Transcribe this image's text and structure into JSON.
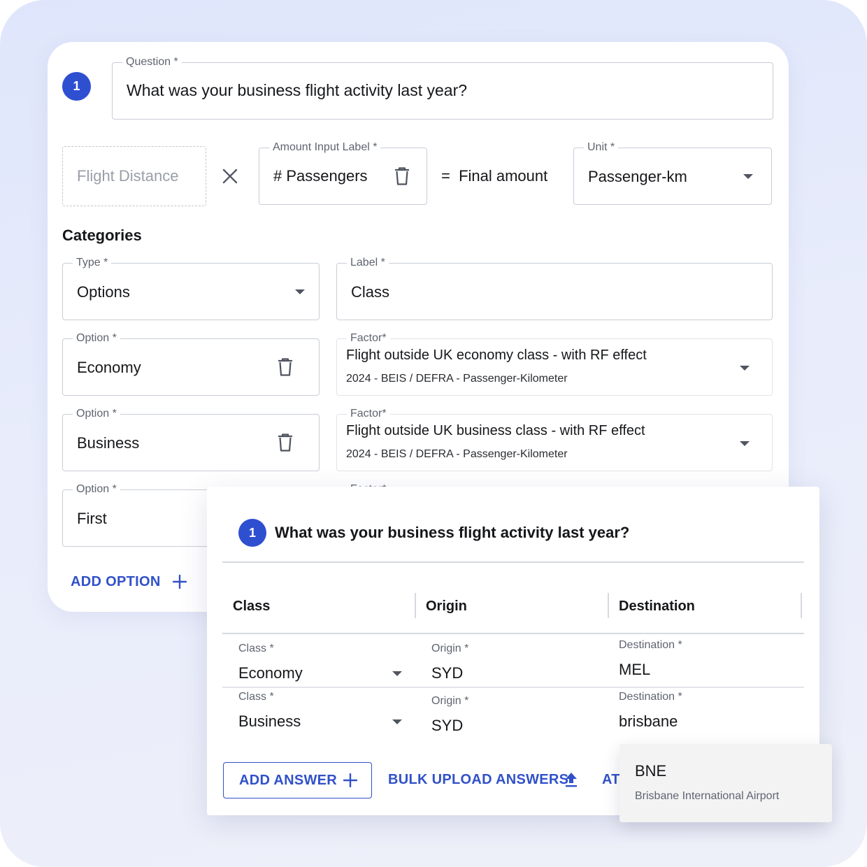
{
  "builder": {
    "step_number": "1",
    "question": {
      "label": "Question *",
      "value": "What was your business flight activity last year?"
    },
    "formula": {
      "distance_placeholder": "Flight Distance",
      "times_symbol": "×",
      "amount_label": {
        "label": "Amount Input Label *",
        "value": "# Passengers"
      },
      "equals_text": "=  Final amount",
      "unit": {
        "label": "Unit *",
        "value": "Passenger-km"
      }
    },
    "categories_heading": "Categories",
    "type_field": {
      "label": "Type *",
      "value": "Options"
    },
    "label_field": {
      "label": "Label *",
      "value": "Class"
    },
    "options": [
      {
        "label": "Option *",
        "value": "Economy",
        "factor_label": "Factor*",
        "factor_title": "Flight outside UK economy class - with RF effect",
        "factor_source": "2024 - BEIS / DEFRA - Passenger-Kilometer"
      },
      {
        "label": "Option *",
        "value": "Business",
        "factor_label": "Factor*",
        "factor_title": "Flight outside UK business class - with RF effect",
        "factor_source": "2024 - BEIS / DEFRA - Passenger-Kilometer"
      },
      {
        "label": "Option *",
        "value": "First",
        "factor_label": "Factor*"
      }
    ],
    "add_option": "ADD OPTION"
  },
  "answer": {
    "step_number": "1",
    "question": "What was your business flight activity last year?",
    "columns": [
      "Class",
      "Origin",
      "Destination"
    ],
    "rows": [
      {
        "class_label": "Class *",
        "class_value": "Economy",
        "origin_label": "Origin *",
        "origin_value": "SYD",
        "destination_label": "Destination *",
        "destination_value": "MEL"
      },
      {
        "class_label": "Class *",
        "class_value": "Business",
        "origin_label": "Origin *",
        "origin_value": "SYD",
        "destination_label": "Destination *",
        "destination_value": "brisbane"
      }
    ],
    "add_answer": "ADD ANSWER",
    "bulk_upload": "BULK UPLOAD ANSWERS",
    "third_action_partial": "AT"
  },
  "autocomplete": {
    "code": "BNE",
    "name": "Brisbane International Airport"
  },
  "colors": {
    "accent": "#2f4fd1",
    "link": "#3151c9",
    "border": "#c9cdd6",
    "background": "#e4e9fb"
  }
}
